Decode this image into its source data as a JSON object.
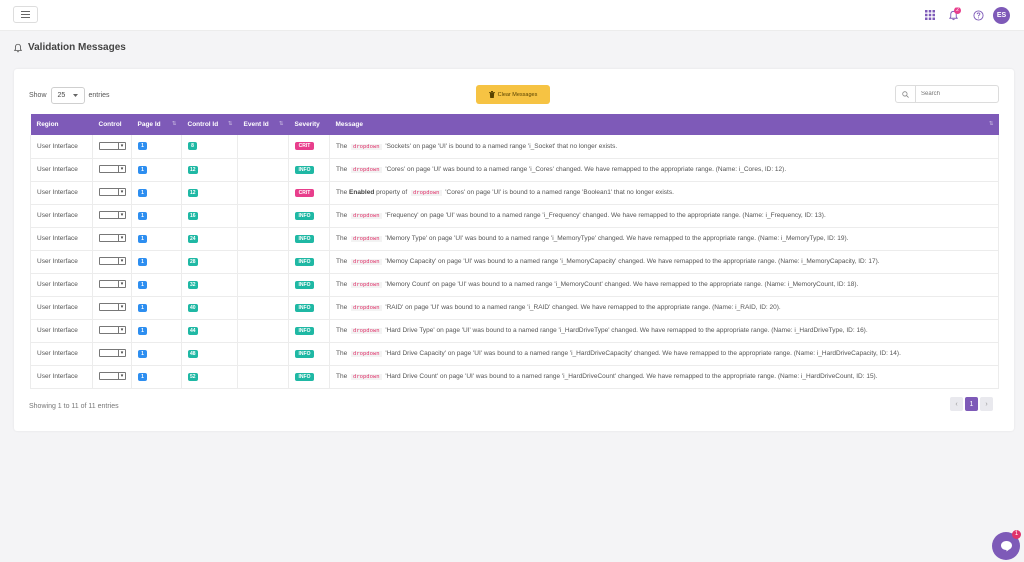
{
  "header": {
    "notification_count": "2",
    "avatar_initials": "ES"
  },
  "page": {
    "title": "Validation Messages"
  },
  "controls": {
    "show_label": "Show",
    "entries_label": "entries",
    "page_length": "25",
    "clear_button": "Clear Messages",
    "search_placeholder": "Search"
  },
  "table": {
    "columns": [
      "Region",
      "Control",
      "Page Id",
      "Control Id",
      "Event Id",
      "Severity",
      "Message"
    ],
    "rows": [
      {
        "region": "User Interface",
        "page_id": "1",
        "control_id": "8",
        "event_id": "",
        "severity": "CRIT",
        "message": [
          {
            "t": "The "
          },
          {
            "k": "dropdown"
          },
          {
            "t": " 'Sockets' on page 'UI' is bound to a named range 'i_Socket' that no longer exists."
          }
        ]
      },
      {
        "region": "User Interface",
        "page_id": "1",
        "control_id": "12",
        "event_id": "",
        "severity": "INFO",
        "message": [
          {
            "t": "The "
          },
          {
            "k": "dropdown"
          },
          {
            "t": " 'Cores' on page 'UI' was bound to a named range 'i_Cores' changed. We have remapped to the appropriate range. (Name: i_Cores, ID: 12)."
          }
        ]
      },
      {
        "region": "User Interface",
        "page_id": "1",
        "control_id": "12",
        "event_id": "",
        "severity": "CRIT",
        "message": [
          {
            "t": "The "
          },
          {
            "b": "Enabled"
          },
          {
            "t": " property of "
          },
          {
            "k": "dropdown"
          },
          {
            "t": " 'Cores' on page 'UI' is bound to a named range 'Boolean1' that no longer exists."
          }
        ]
      },
      {
        "region": "User Interface",
        "page_id": "1",
        "control_id": "16",
        "event_id": "",
        "severity": "INFO",
        "message": [
          {
            "t": "The "
          },
          {
            "k": "dropdown"
          },
          {
            "t": " 'Frequency' on page 'UI' was bound to a named range 'i_Frequency' changed. We have remapped to the appropriate range. (Name: i_Frequency, ID: 13)."
          }
        ]
      },
      {
        "region": "User Interface",
        "page_id": "1",
        "control_id": "24",
        "event_id": "",
        "severity": "INFO",
        "message": [
          {
            "t": "The "
          },
          {
            "k": "dropdown"
          },
          {
            "t": " 'Memory Type' on page 'UI' was bound to a named range 'i_MemoryType' changed. We have remapped to the appropriate range. (Name: i_MemoryType, ID: 19)."
          }
        ]
      },
      {
        "region": "User Interface",
        "page_id": "1",
        "control_id": "28",
        "event_id": "",
        "severity": "INFO",
        "message": [
          {
            "t": "The "
          },
          {
            "k": "dropdown"
          },
          {
            "t": " 'Memoy Capacity' on page 'UI' was bound to a named range 'i_MemoryCapacity' changed. We have remapped to the appropriate range. (Name: i_MemoryCapacity, ID: 17)."
          }
        ]
      },
      {
        "region": "User Interface",
        "page_id": "1",
        "control_id": "32",
        "event_id": "",
        "severity": "INFO",
        "message": [
          {
            "t": "The "
          },
          {
            "k": "dropdown"
          },
          {
            "t": " 'Memory Count' on page 'UI' was bound to a named range 'i_MemoryCount' changed. We have remapped to the appropriate range. (Name: i_MemoryCount, ID: 18)."
          }
        ]
      },
      {
        "region": "User Interface",
        "page_id": "1",
        "control_id": "40",
        "event_id": "",
        "severity": "INFO",
        "message": [
          {
            "t": "The "
          },
          {
            "k": "dropdown"
          },
          {
            "t": " 'RAID' on page 'UI' was bound to a named range 'i_RAID' changed. We have remapped to the appropriate range. (Name: i_RAID, ID: 20)."
          }
        ]
      },
      {
        "region": "User Interface",
        "page_id": "1",
        "control_id": "44",
        "event_id": "",
        "severity": "INFO",
        "message": [
          {
            "t": "The "
          },
          {
            "k": "dropdown"
          },
          {
            "t": " 'Hard Drive Type' on page 'UI' was bound to a named range 'i_HardDriveType' changed. We have remapped to the appropriate range. (Name: i_HardDriveType, ID: 16)."
          }
        ]
      },
      {
        "region": "User Interface",
        "page_id": "1",
        "control_id": "48",
        "event_id": "",
        "severity": "INFO",
        "message": [
          {
            "t": "The "
          },
          {
            "k": "dropdown"
          },
          {
            "t": " 'Hard Drive Capacity' on page 'UI' was bound to a named range 'i_HardDriveCapacity' changed. We have remapped to the appropriate range. (Name: i_HardDriveCapacity, ID: 14)."
          }
        ]
      },
      {
        "region": "User Interface",
        "page_id": "1",
        "control_id": "52",
        "event_id": "",
        "severity": "INFO",
        "message": [
          {
            "t": "The "
          },
          {
            "k": "dropdown"
          },
          {
            "t": " 'Hard Drive Count' on page 'UI' was bound to a named range 'i_HardDriveCount' changed. We have remapped to the appropriate range. (Name: i_HardDriveCount, ID: 15)."
          }
        ]
      }
    ]
  },
  "footer": {
    "info": "Showing 1 to 11 of 11 entries",
    "pagination": {
      "prev": "‹",
      "current": "1",
      "next": "›"
    }
  },
  "chat": {
    "badge": "1"
  },
  "colors": {
    "accent": "#7e5ab8",
    "crit": "#e83e8c",
    "info": "#1fb8a4",
    "page_badge": "#2d8ef0",
    "warning_button": "#f6c343"
  }
}
